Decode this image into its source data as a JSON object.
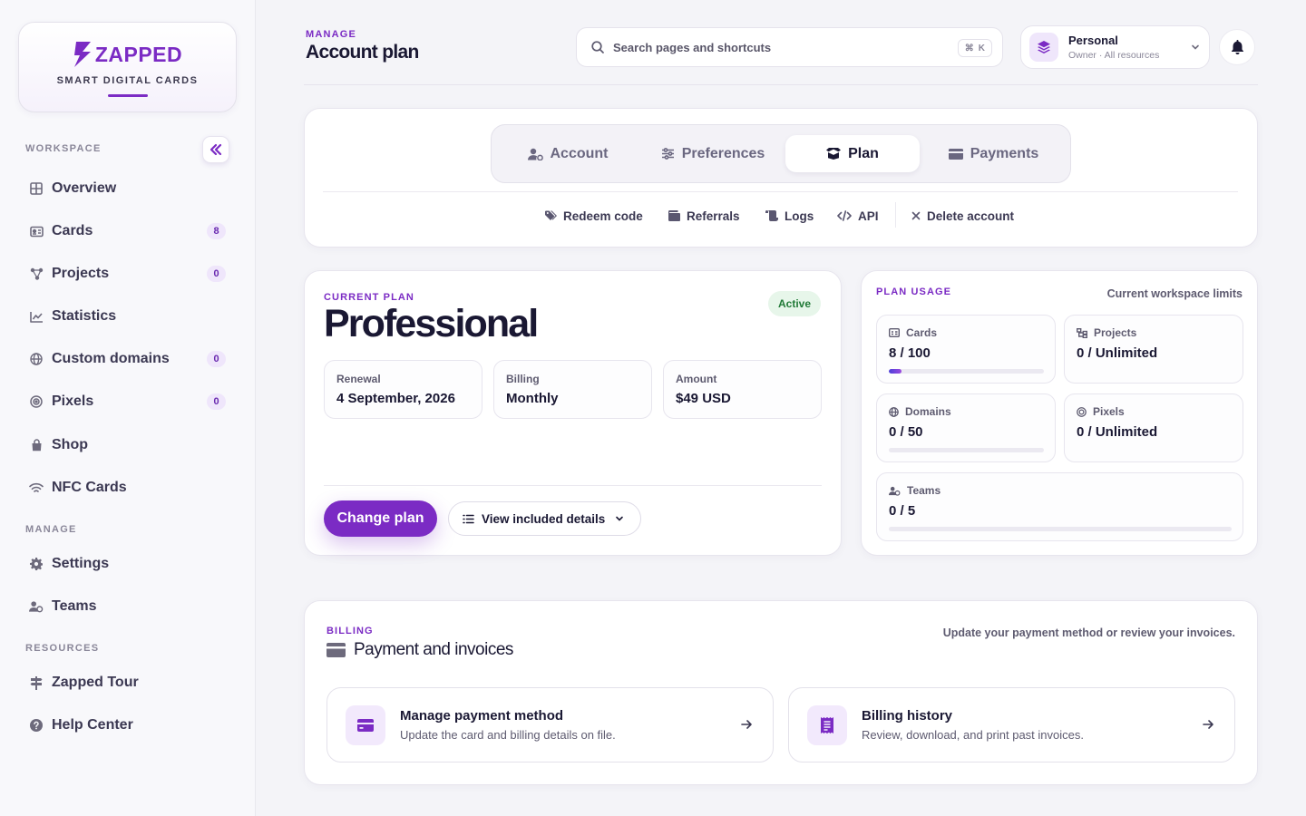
{
  "brand": {
    "name": "ZAPPED",
    "tagline": "SMART DIGITAL CARDS",
    "accent": "#7b2bc4"
  },
  "sidebar": {
    "sections": {
      "workspace": "WORKSPACE",
      "manage": "MANAGE",
      "resources": "RESOURCES"
    },
    "workspace_items": [
      {
        "label": "Overview",
        "icon": "grid-icon"
      },
      {
        "label": "Cards",
        "icon": "id-card-icon",
        "badge": "8"
      },
      {
        "label": "Projects",
        "icon": "nodes-icon",
        "badge": "0"
      },
      {
        "label": "Statistics",
        "icon": "chart-line-icon"
      },
      {
        "label": "Custom domains",
        "icon": "globe-icon",
        "badge": "0"
      },
      {
        "label": "Pixels",
        "icon": "target-icon",
        "badge": "0"
      },
      {
        "label": "Shop",
        "icon": "bag-icon"
      },
      {
        "label": "NFC Cards",
        "icon": "wifi-icon"
      }
    ],
    "manage_items": [
      {
        "label": "Settings",
        "icon": "gear-icon"
      },
      {
        "label": "Teams",
        "icon": "users-icon"
      }
    ],
    "resource_items": [
      {
        "label": "Zapped Tour",
        "icon": "signpost-icon"
      },
      {
        "label": "Help Center",
        "icon": "question-icon"
      }
    ]
  },
  "header": {
    "eyebrow": "MANAGE",
    "title": "Account plan",
    "search_placeholder": "Search pages and shortcuts",
    "shortcut_keys": [
      "⌘",
      "K"
    ],
    "account": {
      "name": "Personal",
      "subtitle": "Owner · All resources"
    }
  },
  "tabs": [
    {
      "label": "Account",
      "icon": "user-gear-icon"
    },
    {
      "label": "Preferences",
      "icon": "sliders-icon"
    },
    {
      "label": "Plan",
      "icon": "box-icon",
      "active": true
    },
    {
      "label": "Payments",
      "icon": "credit-card-icon"
    }
  ],
  "sub_links": [
    {
      "label": "Redeem code",
      "icon": "tags-icon"
    },
    {
      "label": "Referrals",
      "icon": "wallet-icon"
    },
    {
      "label": "Logs",
      "icon": "scroll-icon"
    },
    {
      "label": "API",
      "icon": "code-icon"
    },
    {
      "label": "Delete account",
      "icon": "close-icon"
    }
  ],
  "plan": {
    "eyebrow": "CURRENT PLAN",
    "name": "Professional",
    "status": "Active",
    "details": [
      {
        "label": "Renewal",
        "value": "4 September, 2026"
      },
      {
        "label": "Billing",
        "value": "Monthly"
      },
      {
        "label": "Amount",
        "value": "$49 USD"
      }
    ],
    "primary_action": "Change plan",
    "secondary_action": "View included details"
  },
  "usage": {
    "eyebrow": "PLAN USAGE",
    "note": "Current workspace limits",
    "items": [
      {
        "label": "Cards",
        "value": "8 / 100",
        "icon": "id-card-icon",
        "fraction": 0.08,
        "bar": true
      },
      {
        "label": "Projects",
        "value": "0 / Unlimited",
        "icon": "sitemap-icon",
        "bar": false
      },
      {
        "label": "Domains",
        "value": "0 / 50",
        "icon": "globe-icon",
        "fraction": 0,
        "bar": true
      },
      {
        "label": "Pixels",
        "value": "0 / Unlimited",
        "icon": "target-icon",
        "bar": false
      },
      {
        "label": "Teams",
        "value": "0 / 5",
        "icon": "users-icon",
        "fraction": 0,
        "bar": true
      }
    ]
  },
  "billing": {
    "eyebrow": "BILLING",
    "title": "Payment and invoices",
    "note": "Update your payment method or review your invoices.",
    "actions": [
      {
        "title": "Manage payment method",
        "desc": "Update the card and billing details on file.",
        "icon": "credit-card-icon"
      },
      {
        "title": "Billing history",
        "desc": "Review, download, and print past invoices.",
        "icon": "receipt-icon"
      }
    ]
  }
}
